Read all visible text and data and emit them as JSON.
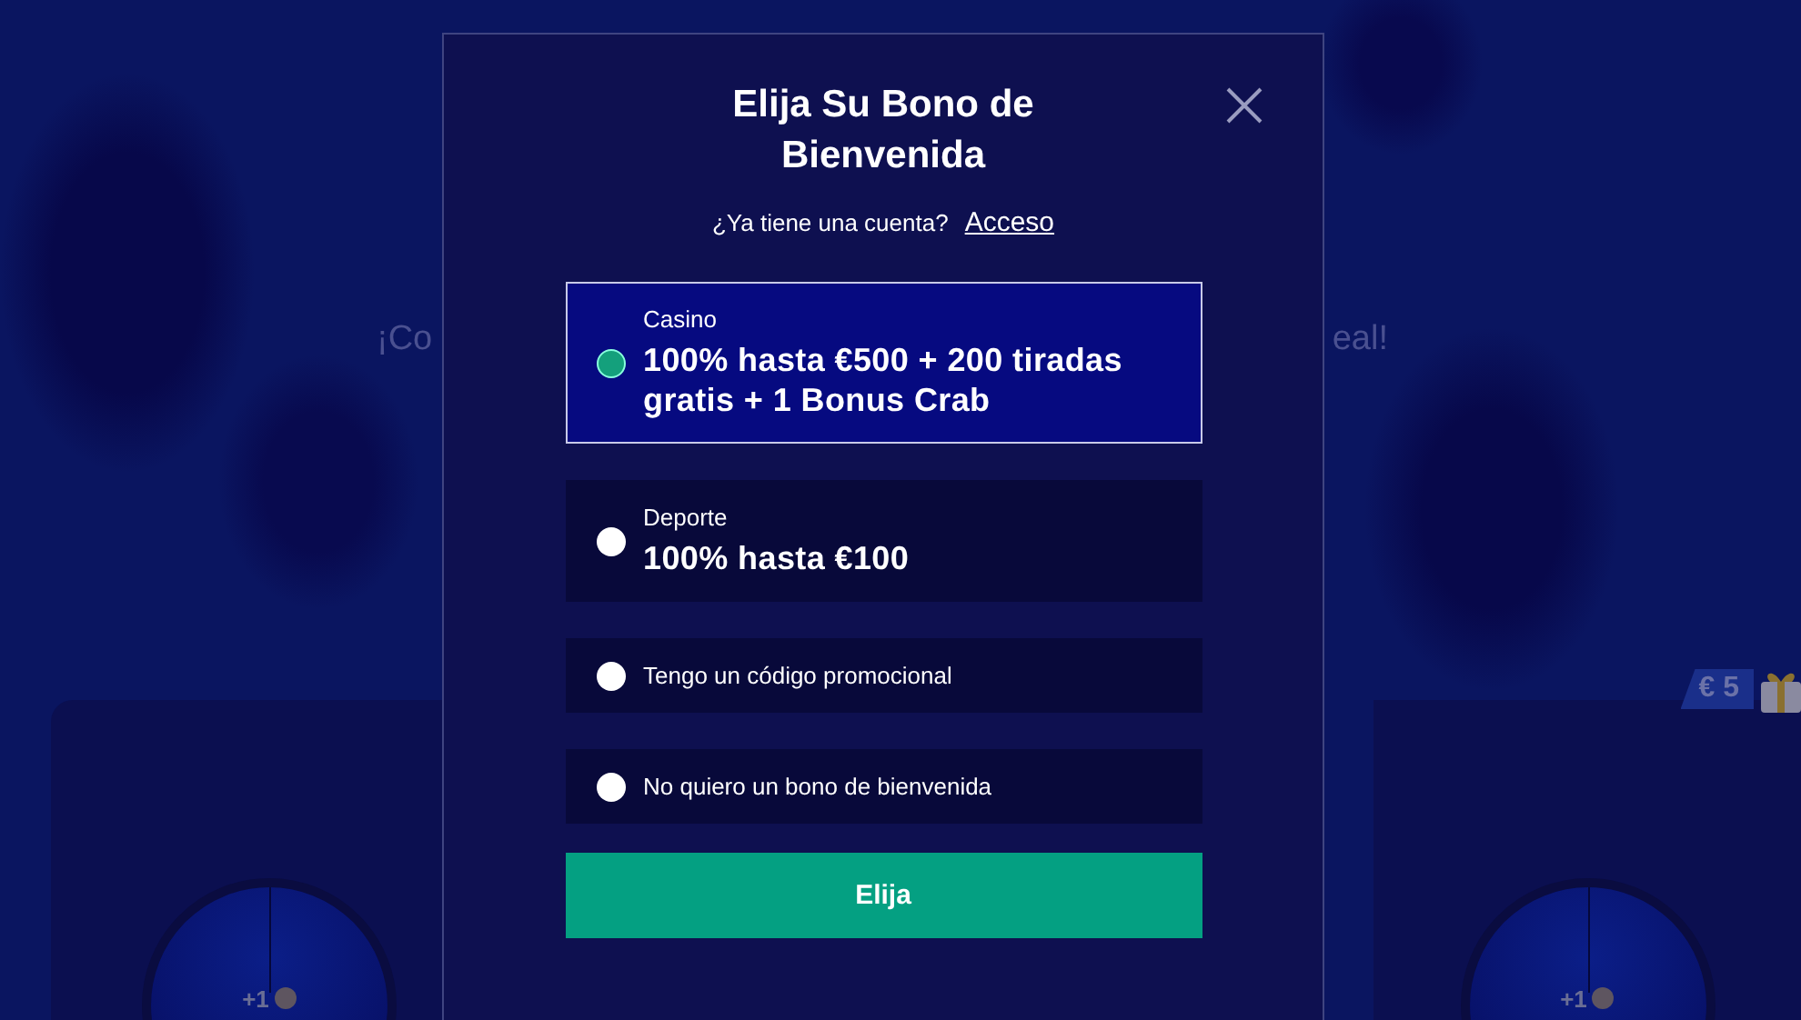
{
  "background": {
    "banner_left": "¡Co",
    "banner_right": "eal!",
    "wheels": [
      {
        "reward": "+1"
      },
      {
        "reward": "+1"
      }
    ],
    "prize_badge": "€ 5"
  },
  "modal": {
    "title": "Elija Su Bono de Bienvenida",
    "subtitle": "¿Ya tiene una cuenta?",
    "login_link": "Acceso",
    "options": [
      {
        "kind": "bonus",
        "category": "Casino",
        "offer": "100% hasta €500 + 200 tiradas gratis + 1 Bonus Crab",
        "selected": true
      },
      {
        "kind": "bonus",
        "category": "Deporte",
        "offer": "100% hasta €100",
        "selected": false
      },
      {
        "kind": "plain",
        "label": "Tengo un código promocional",
        "selected": false
      },
      {
        "kind": "plain",
        "label": "No quiero un bono de bienvenida",
        "selected": false
      }
    ],
    "submit": "Elija"
  }
}
